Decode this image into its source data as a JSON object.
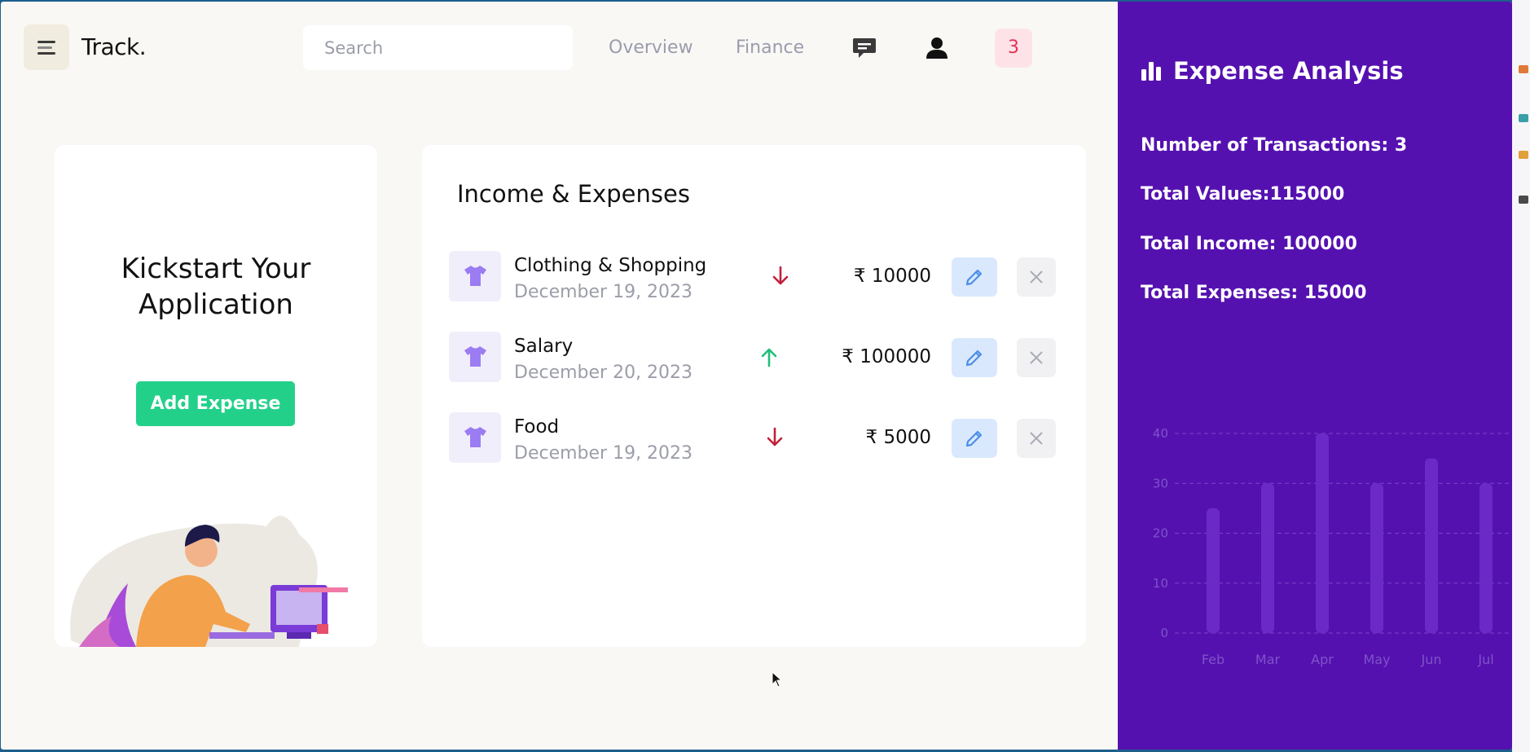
{
  "brand": "Track.",
  "search": {
    "placeholder": "Search"
  },
  "nav": {
    "overview": "Overview",
    "finance": "Finance"
  },
  "notifications": {
    "count": "3"
  },
  "icons": {
    "menu": "menu-icon",
    "chat": "chat-icon",
    "user": "user-icon",
    "tshirt": "tshirt-icon",
    "edit": "pencil-icon",
    "delete": "close-icon",
    "stats": "bar-chart-icon"
  },
  "kickstart": {
    "title_line1": "Kickstart Your",
    "title_line2": "Application",
    "button": "Add Expense"
  },
  "transactions": {
    "title": "Income & Expenses",
    "items": [
      {
        "category": "Clothing & Shopping",
        "date": "December 19, 2023",
        "direction": "down",
        "amount": "₹ 10000"
      },
      {
        "category": "Salary",
        "date": "December 20, 2023",
        "direction": "up",
        "amount": "₹ 100000"
      },
      {
        "category": "Food",
        "date": "December 19, 2023",
        "direction": "down",
        "amount": "₹ 5000"
      }
    ]
  },
  "analysis": {
    "title": "Expense Analysis",
    "transactions": "Number of Transactions: 3",
    "total_values": "Total Values:115000",
    "total_income": "Total Income: 100000",
    "total_expenses": "Total Expenses: 15000"
  },
  "colors": {
    "panel": "#5511b0",
    "accent_green": "#23d08a",
    "arrow_up": "#1fbf7a",
    "arrow_down": "#c0213a",
    "edit_blue": "#4d8ee8"
  },
  "chart_data": {
    "type": "bar",
    "categories": [
      "Feb",
      "Mar",
      "Apr",
      "May",
      "Jun",
      "Jul"
    ],
    "values": [
      25,
      30,
      40,
      30,
      35,
      30
    ],
    "ylim": [
      0,
      40
    ],
    "yticks": [
      "0",
      "10",
      "20",
      "30",
      "40"
    ],
    "grid": true
  }
}
